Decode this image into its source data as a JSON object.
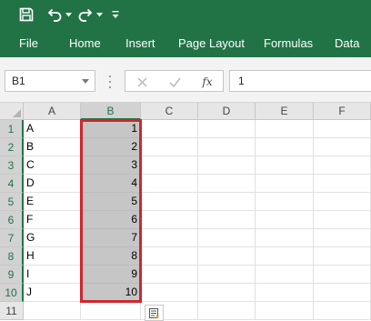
{
  "quick_access": {
    "items": [
      {
        "name": "save",
        "icon": "save-icon"
      },
      {
        "name": "undo",
        "icon": "undo-icon"
      },
      {
        "name": "undo-dropdown",
        "icon": "chevron-down-icon"
      },
      {
        "name": "redo",
        "icon": "redo-icon"
      },
      {
        "name": "redo-dropdown",
        "icon": "chevron-down-icon"
      },
      {
        "name": "customize",
        "icon": "customize-icon"
      }
    ]
  },
  "ribbon": {
    "tabs": [
      {
        "label": "File"
      },
      {
        "label": "Home"
      },
      {
        "label": "Insert"
      },
      {
        "label": "Page Layout"
      },
      {
        "label": "Formulas"
      },
      {
        "label": "Data"
      }
    ]
  },
  "formula_bar": {
    "name_box": "B1",
    "cancel_icon": "cancel-icon",
    "enter_icon": "checkmark-icon",
    "fx_label": "fx",
    "content": "1"
  },
  "sheet": {
    "columns": [
      "A",
      "B",
      "C",
      "D",
      "E",
      "F"
    ],
    "selected_column": "B",
    "rows": [
      {
        "num": "1",
        "a": "A",
        "b": "1"
      },
      {
        "num": "2",
        "a": "B",
        "b": "2"
      },
      {
        "num": "3",
        "a": "C",
        "b": "3"
      },
      {
        "num": "4",
        "a": "D",
        "b": "4"
      },
      {
        "num": "5",
        "a": "E",
        "b": "5"
      },
      {
        "num": "6",
        "a": "F",
        "b": "6"
      },
      {
        "num": "7",
        "a": "G",
        "b": "7"
      },
      {
        "num": "8",
        "a": "H",
        "b": "8"
      },
      {
        "num": "9",
        "a": "I",
        "b": "9"
      },
      {
        "num": "10",
        "a": "J",
        "b": "10"
      },
      {
        "num": "11",
        "a": "",
        "b": ""
      }
    ],
    "selected_range": "B1:B10",
    "quick_analysis_icon": "quick-analysis-icon"
  },
  "colors": {
    "ribbon": "#217346",
    "selection_fill": "#c6c6c6",
    "highlight_border": "#d0262b"
  }
}
